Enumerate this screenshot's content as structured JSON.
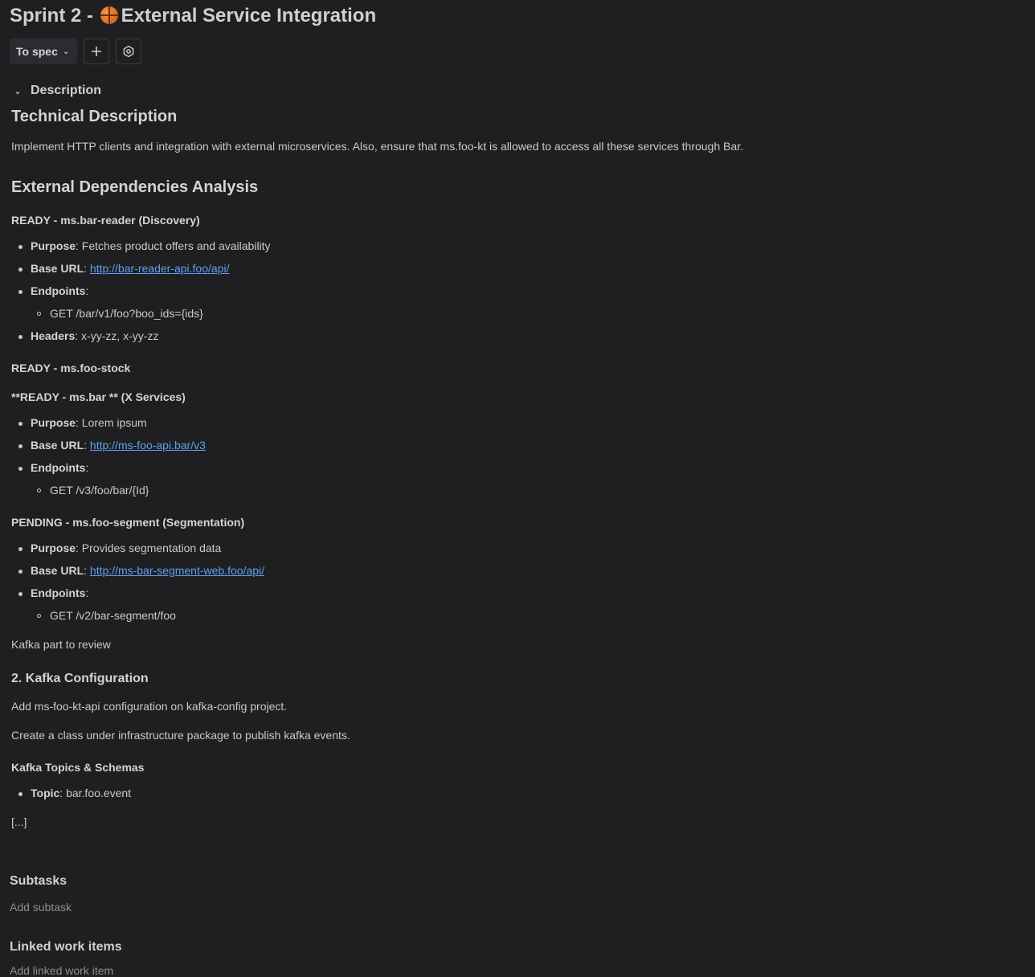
{
  "header": {
    "title_prefix": "Sprint 2 - ",
    "title_emoji_icon": "basketball-icon",
    "title_text": "External Service Integration"
  },
  "toolbar": {
    "status_label": "To spec",
    "add_icon": "plus-icon",
    "settings_icon": "settings-icon"
  },
  "description": {
    "label": "Description",
    "heading": "Technical Description",
    "intro": "Implement HTTP clients and integration with external microservices. Also, ensure that ms.foo-kt is allowed to access all these services through Bar.",
    "deps_heading": "External Dependencies Analysis",
    "dep1": {
      "title": "READY - ms.bar-reader (Discovery)",
      "purpose_label": "Purpose",
      "purpose_value": ": Fetches product offers and availability",
      "baseurl_label": "Base URL",
      "baseurl_sep": ": ",
      "baseurl_value": "http://bar-reader-api.foo/api/",
      "endpoints_label": "Endpoints",
      "endpoints_sep": ":",
      "endpoint": "GET /bar/v1/foo?boo_ids={ids}",
      "headers_label": "Headers",
      "headers_value": ": x-yy-zz, x-yy-zz"
    },
    "dep2": {
      "title": "READY - ms.foo-stock"
    },
    "dep3": {
      "title": "**READY - ms.bar ** (X Services)",
      "purpose_label": "Purpose",
      "purpose_value": ": Lorem ipsum",
      "baseurl_label": "Base URL",
      "baseurl_sep": ": ",
      "baseurl_value": "http://ms-foo-api.bar/v3",
      "endpoints_label": "Endpoints",
      "endpoints_sep": ":",
      "endpoint": "GET /v3/foo/bar/{Id}"
    },
    "dep4": {
      "title": "PENDING - ms.foo-segment (Segmentation)",
      "purpose_label": "Purpose",
      "purpose_value": ": Provides segmentation data",
      "baseurl_label": "Base URL",
      "baseurl_sep": ": ",
      "baseurl_value": "http://ms-bar-segment-web.foo/api/",
      "endpoints_label": "Endpoints",
      "endpoints_sep": ":",
      "endpoint": "GET /v2/bar-segment/foo"
    },
    "kafka_note": "Kafka part to review",
    "kafka_heading": "2. Kafka Configuration",
    "kafka_p1": "Add ms-foo-kt-api configuration on kafka-config project.",
    "kafka_p2": "Create a class under infrastructure package to publish kafka events.",
    "topics_heading": "Kafka Topics & Schemas",
    "topic_label": "Topic",
    "topic_value": ": bar.foo.event",
    "ellipsis": "[...]"
  },
  "subtasks": {
    "title": "Subtasks",
    "add": "Add subtask"
  },
  "linked": {
    "title": "Linked work items",
    "add": "Add linked work item"
  }
}
